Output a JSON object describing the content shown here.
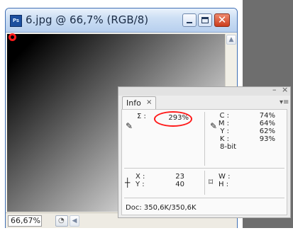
{
  "document_window": {
    "title": "6.jpg @ 66,7% (RGB/8)",
    "app_icon_text": "Ps",
    "icons": {
      "minimize": "minimize-icon",
      "maximize": "maximize-icon",
      "close": "close-icon"
    },
    "zoom": "66,67%"
  },
  "info_panel": {
    "tab_label": "Info",
    "tab_close": "×",
    "minimize_symbol": "–",
    "close_symbol": "×",
    "menu_symbol": "▾≡",
    "total_ink": {
      "label": "Σ :",
      "value": "293%"
    },
    "cmyk": {
      "labels": [
        "C :",
        "M :",
        "Y :",
        "K :"
      ],
      "values": [
        "74%",
        "64%",
        "62%",
        "93%"
      ],
      "bit_depth": "8-bit"
    },
    "position": {
      "x_label": "X :",
      "y_label": "Y :",
      "x_value": "23",
      "y_value": "40"
    },
    "size": {
      "w_label": "W :",
      "h_label": "H :"
    },
    "doc_size": "Doc: 350,6K/350,6K"
  },
  "colors": {
    "highlight": "#ff1a1a",
    "title_text": "#1b2c45",
    "workspace_gray": "#6e6e6e"
  }
}
